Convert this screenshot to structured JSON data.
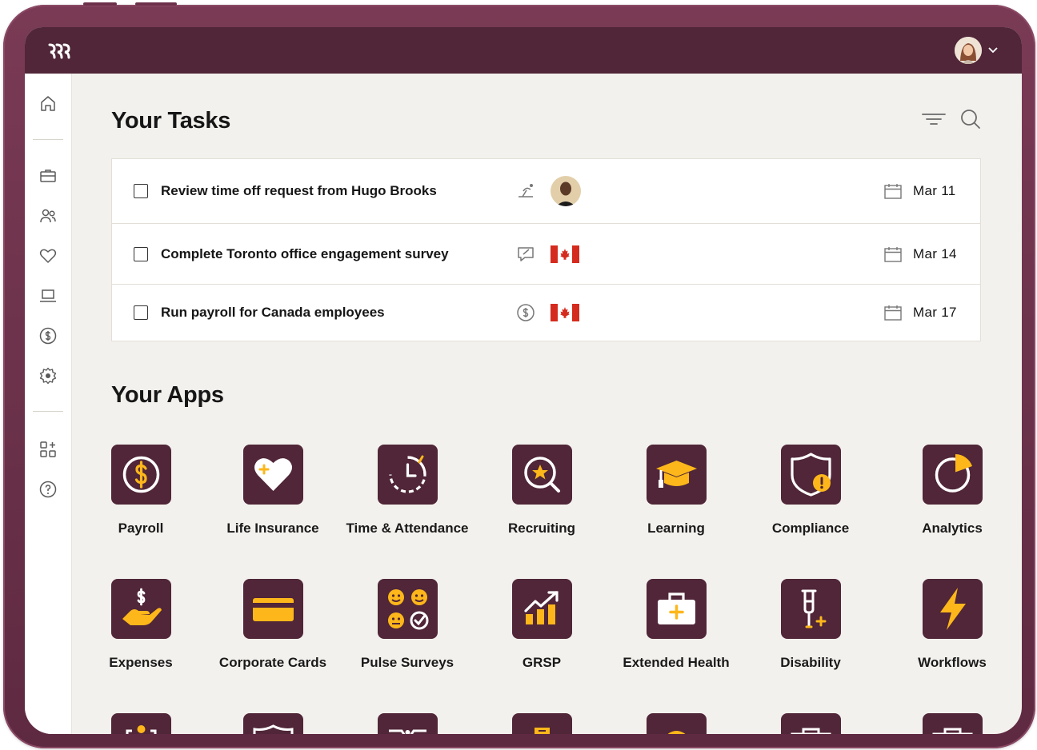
{
  "tasks_section": {
    "title": "Your Tasks"
  },
  "tasks": [
    {
      "text": "Review time off request from Hugo Brooks",
      "type_icon": "beach-umbrella-icon",
      "badge": "avatar-hugo-brooks",
      "date": "Mar 11"
    },
    {
      "text": "Complete Toronto office engagement survey",
      "type_icon": "survey-chat-icon",
      "badge": "canada-flag",
      "date": "Mar 14"
    },
    {
      "text": "Run payroll for Canada employees",
      "type_icon": "dollar-coin-icon",
      "badge": "canada-flag",
      "date": "Mar 17"
    }
  ],
  "apps_section": {
    "title": "Your Apps"
  },
  "apps": [
    {
      "label": "Payroll",
      "icon": "payroll-icon"
    },
    {
      "label": "Life Insurance",
      "icon": "heart-plus-icon"
    },
    {
      "label": "Time & Attendance",
      "icon": "clock-icon"
    },
    {
      "label": "Recruiting",
      "icon": "magnifier-star-icon"
    },
    {
      "label": "Learning",
      "icon": "graduation-cap-icon"
    },
    {
      "label": "Compliance",
      "icon": "shield-alert-icon"
    },
    {
      "label": "Analytics",
      "icon": "pie-chart-icon"
    },
    {
      "label": "Expenses",
      "icon": "hand-dollar-icon"
    },
    {
      "label": "Corporate Cards",
      "icon": "credit-card-icon"
    },
    {
      "label": "Pulse Surveys",
      "icon": "faces-icon"
    },
    {
      "label": "GRSP",
      "icon": "growth-chart-icon"
    },
    {
      "label": "Extended Health",
      "icon": "medical-kit-icon"
    },
    {
      "label": "Disability",
      "icon": "crutch-icon"
    },
    {
      "label": "Workflows",
      "icon": "lightning-icon"
    }
  ],
  "sidebar": {
    "items": [
      "home-icon",
      "briefcase-icon",
      "people-icon",
      "heart-icon",
      "laptop-icon",
      "dollar-coin-icon",
      "gear-icon",
      "apps-add-icon",
      "help-icon"
    ]
  },
  "colors": {
    "brand_dark": "#502638",
    "device_frame": "#6d304a",
    "accent_yellow": "#fdb71a",
    "background": "#f3f1ed"
  }
}
